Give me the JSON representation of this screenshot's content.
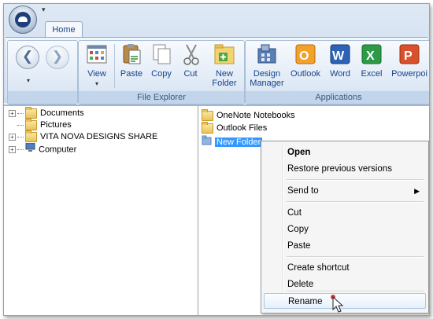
{
  "ribbon": {
    "tab": "Home",
    "groups": {
      "explorer_title": "File Explorer",
      "apps_title": "Applications"
    },
    "buttons": {
      "view": "View",
      "paste": "Paste",
      "copy": "Copy",
      "cut": "Cut",
      "new_folder_1": "New",
      "new_folder_2": "Folder",
      "design_manager_1": "Design",
      "design_manager_2": "Manager",
      "outlook": "Outlook",
      "word": "Word",
      "excel": "Excel",
      "powerpoint": "Powerpoi"
    }
  },
  "tree": {
    "items": [
      {
        "label": "Documents"
      },
      {
        "label": "Pictures"
      },
      {
        "label": "VITA NOVA DESIGNS SHARE"
      },
      {
        "label": "Computer"
      }
    ]
  },
  "files": {
    "items": [
      {
        "label": "OneNote Notebooks"
      },
      {
        "label": "Outlook Files"
      },
      {
        "label": "New Folder"
      }
    ]
  },
  "context_menu": {
    "open": "Open",
    "restore": "Restore previous versions",
    "send_to": "Send to",
    "cut": "Cut",
    "copy": "Copy",
    "paste": "Paste",
    "create_shortcut": "Create shortcut",
    "delete": "Delete",
    "rename": "Rename"
  },
  "colors": {
    "ribbon_text": "#15428b",
    "selection": "#3399ff",
    "menu_bg": "#f5f5f5"
  }
}
